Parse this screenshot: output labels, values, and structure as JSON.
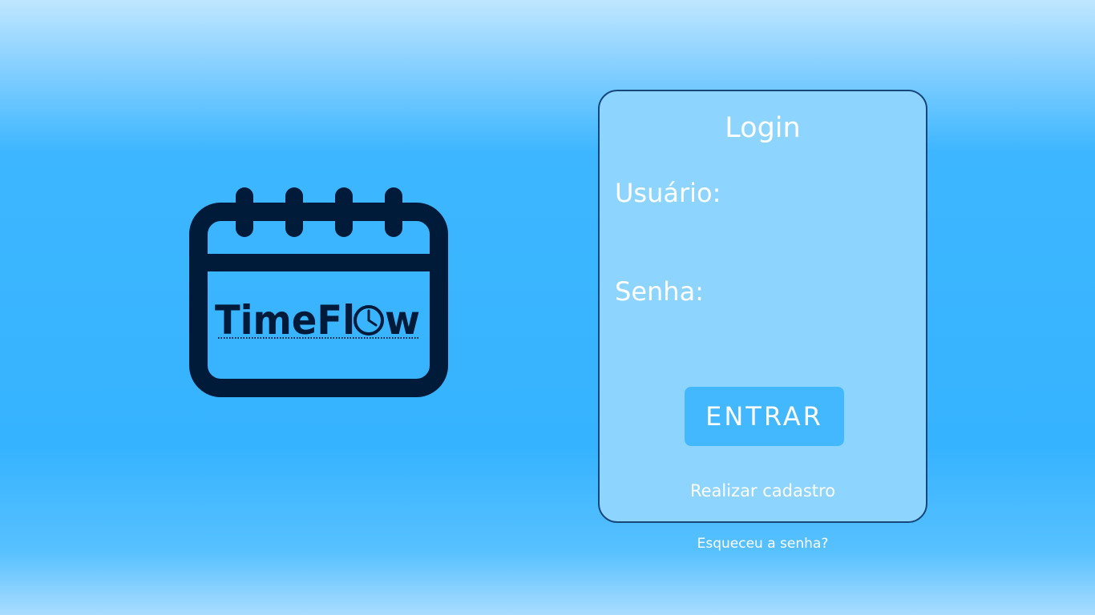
{
  "logo": {
    "icon": "calendar-icon",
    "text": "TimeFl",
    "text_tail": "w",
    "clock_icon": "clock-icon",
    "color": "#001a3a"
  },
  "login": {
    "title": "Login",
    "username_label": "Usuário:",
    "username_value": "",
    "password_label": "Senha:",
    "password_value": "",
    "submit_label": "ENTRAR",
    "signup_link": "Realizar cadastro",
    "forgot_link": "Esqueceu a senha?"
  },
  "colors": {
    "card_background": "#8dd4ff",
    "card_border": "#16467a",
    "button": "#43b8ff",
    "text": "#ffffff"
  }
}
